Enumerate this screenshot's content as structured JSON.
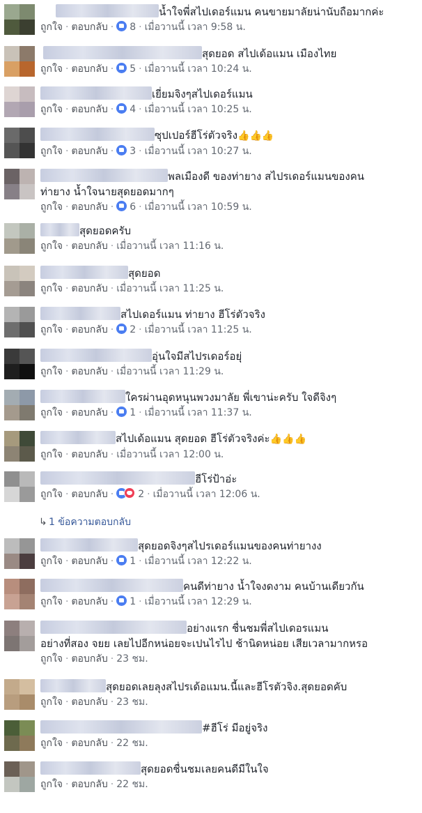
{
  "labels": {
    "like": "ถูกใจ",
    "reply": "ตอบกลับ",
    "sep": "·"
  },
  "comments": [
    {
      "text": "น้ำใจพี่สไปเดอร์แมน คนขายมาลัยน่านับถือมากค่ะ",
      "reactions": "8",
      "time": "เมื่อวานนี้ เวลา 9:58 น."
    },
    {
      "text": "สุดยอด สไปเด้อแมน เมืองไทย",
      "reactions": "5",
      "time": "เมื่อวานนี้ เวลา 10:24 น."
    },
    {
      "text": "เยี่ยมจิงๆสไปเดอร์แมน",
      "reactions": "4",
      "time": "เมื่อวานนี้ เวลา 10:25 น."
    },
    {
      "text": "ซุปเปอร์ฮีโร่ตัวจริง",
      "emoji": "👍👍👍",
      "reactions": "3",
      "time": "เมื่อวานนี้ เวลา 10:27 น."
    },
    {
      "text": "พลเมืองดี ของท่ายาง สไปรเดอร์แมนของคน",
      "text2": "ท่ายาง น้ำใจนายสุดยอดมากๆ",
      "reactions": "6",
      "time": "เมื่อวานนี้ เวลา 10:59 น."
    },
    {
      "text": "สุดยอดครับ",
      "time": "เมื่อวานนี้ เวลา 11:16 น."
    },
    {
      "text": "สุดยอด",
      "time": "เมื่อวานนี้ เวลา 11:25 น."
    },
    {
      "text": "สไปเดอร์แมน ท่ายาง ฮีโร่ตัวจริง",
      "reactions": "2",
      "time": "เมื่อวานนี้ เวลา 11:25 น."
    },
    {
      "text": "อุ่นใจมีสไปรเดอร์อยุ่",
      "time": "เมื่อวานนี้ เวลา 11:29 น."
    },
    {
      "text": "ใครผ่านอุดหนุนพวงมาลัย พี่เขาน่ะครับ ใจดีจิงๆ",
      "reactions": "1",
      "time": "เมื่อวานนี้ เวลา 11:37 น."
    },
    {
      "text": "สไปเด้อแมน สุดยอด ฮีโร่ตัวจริงค่ะ",
      "emoji": "👍👍👍",
      "time": "เมื่อวานนี้ เวลา 12:00 น."
    },
    {
      "text": "ฮีโร่ป้าอ่ะ",
      "reactions": "2",
      "love": true,
      "time": "เมื่อวานนี้ เวลา 12:06 น."
    },
    {
      "text": "สุดยอดจิงๆสไปรเดอร์แมนของคนท่ายางง",
      "reactions": "1",
      "time": "เมื่อวานนี้ เวลา 12:22 น."
    },
    {
      "text": "คนดีท่ายาง น้ำใจงดงาม คนบ้านเดียวกัน",
      "reactions": "1",
      "time": "เมื่อวานนี้ เวลา 12:29 น."
    },
    {
      "text": "อย่างแรก ชื่นชมพี่สไปเดอรแมน",
      "text2": "อย่างที่สอง จยย เลยไปอีกหน่อยจะเปนไรไป ช้านิดหน่อย เสียเวลามากหรอ",
      "time": "23 ชม."
    },
    {
      "text": "สุดยอดเลยลุงสไปรเด้อแมน.นี้และฮีโรตัวจิง.สุดยอดคับ",
      "time": "23 ชม."
    },
    {
      "text": "#ฮีโร่ มีอยู่จริง",
      "time": "22 ชม."
    },
    {
      "text": "สุดยอดชื่นชมเลยคนดีมีในใจ",
      "time": "22 ชม."
    }
  ],
  "reply_thread": {
    "label": "1 ข้อความตอบกลับ"
  }
}
